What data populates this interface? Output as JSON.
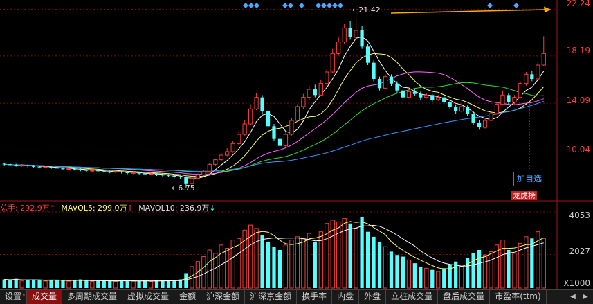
{
  "price_axis": {
    "labels": [
      {
        "value": "22.24",
        "color": "#ff3b3b"
      },
      {
        "value": "18.19",
        "color": "#ff3b3b"
      },
      {
        "value": "14.09",
        "color": "#ff3b3b"
      },
      {
        "value": "10.04",
        "color": "#ff3b3b"
      }
    ]
  },
  "volume_axis": {
    "labels": [
      {
        "value": "4053"
      },
      {
        "value": "2027"
      },
      {
        "value": "X1000"
      }
    ]
  },
  "annotations": {
    "high": "21.42",
    "low": "6.75"
  },
  "volume_legend": {
    "total_label": "总手: 292.9万",
    "total_arrow": "↑",
    "ma5_label": "MAVOL5: 299.0万",
    "ma5_arrow": "↑",
    "ma10_label": "MAVOL10: 236.9万",
    "ma10_arrow": "↓"
  },
  "add_select_button": "加自选",
  "rank_badge": "龙虎榜",
  "tabs": [
    {
      "label": "设置",
      "dot": true,
      "active": false
    },
    {
      "label": "成交量",
      "dot": false,
      "active": true
    },
    {
      "label": "多周期成交量",
      "dot": false,
      "active": false
    },
    {
      "label": "虚拟成交量",
      "dot": false,
      "active": false
    },
    {
      "label": "金额",
      "dot": false,
      "active": false
    },
    {
      "label": "沪深金额",
      "dot": false,
      "active": false
    },
    {
      "label": "沪深京金额",
      "dot": false,
      "active": false
    },
    {
      "label": "换手率",
      "dot": false,
      "active": false
    },
    {
      "label": "内盘",
      "dot": false,
      "active": false
    },
    {
      "label": "外盘",
      "dot": false,
      "active": false
    },
    {
      "label": "立桩成交量",
      "dot": false,
      "active": false
    },
    {
      "label": "盘后成交量",
      "dot": false,
      "active": false
    },
    {
      "label": "市盈率(ttm)",
      "dot": false,
      "active": false
    }
  ],
  "colors": {
    "up": "#ff3b3b",
    "down": "#54ffff",
    "ma5": "#ffffff",
    "ma10": "#ffff66",
    "ma20": "#ff66ff",
    "ma30": "#33dd33",
    "ma60": "#3399ff",
    "grid": "#7a1010"
  },
  "chart_data": {
    "type": "candlestick",
    "price_ylim": [
      6.0,
      22.8
    ],
    "volume_ylim_x1000": [
      0,
      4600
    ],
    "candles": [
      [
        8.85,
        8.8,
        8.95,
        8.7,
        520
      ],
      [
        8.8,
        8.75,
        8.9,
        8.65,
        480
      ],
      [
        8.75,
        8.7,
        8.85,
        8.6,
        560
      ],
      [
        8.7,
        8.72,
        8.82,
        8.6,
        430
      ],
      [
        8.72,
        8.65,
        8.8,
        8.55,
        470
      ],
      [
        8.65,
        8.6,
        8.75,
        8.5,
        520
      ],
      [
        8.6,
        8.55,
        8.7,
        8.45,
        460
      ],
      [
        8.55,
        8.58,
        8.68,
        8.45,
        420
      ],
      [
        8.58,
        8.5,
        8.65,
        8.4,
        500
      ],
      [
        8.5,
        8.45,
        8.6,
        8.35,
        480
      ],
      [
        8.45,
        8.4,
        8.55,
        8.3,
        440
      ],
      [
        8.4,
        8.42,
        8.52,
        8.3,
        410
      ],
      [
        8.42,
        8.35,
        8.5,
        8.25,
        460
      ],
      [
        8.35,
        8.3,
        8.45,
        8.2,
        520
      ],
      [
        8.3,
        8.25,
        8.4,
        8.15,
        440
      ],
      [
        8.25,
        8.28,
        8.38,
        8.15,
        400
      ],
      [
        8.28,
        8.2,
        8.35,
        8.1,
        430
      ],
      [
        8.2,
        8.15,
        8.3,
        8.05,
        470
      ],
      [
        8.15,
        8.12,
        8.25,
        8.02,
        420
      ],
      [
        8.12,
        8.18,
        8.28,
        8.05,
        400
      ],
      [
        8.18,
        8.1,
        8.25,
        8.0,
        440
      ],
      [
        8.1,
        8.05,
        8.2,
        7.95,
        460
      ],
      [
        8.05,
        8.08,
        8.18,
        7.95,
        410
      ],
      [
        8.08,
        8.0,
        8.15,
        7.9,
        430
      ],
      [
        8.0,
        7.95,
        8.1,
        7.85,
        450
      ],
      [
        7.95,
        7.98,
        8.08,
        7.85,
        400
      ],
      [
        7.98,
        7.9,
        8.05,
        7.8,
        470
      ],
      [
        7.9,
        7.85,
        8.0,
        7.75,
        440
      ],
      [
        7.85,
        7.8,
        7.95,
        7.7,
        460
      ],
      [
        7.8,
        7.75,
        7.9,
        7.65,
        490
      ],
      [
        7.75,
        7.7,
        7.85,
        7.55,
        520
      ],
      [
        7.7,
        7.15,
        7.75,
        6.75,
        900
      ],
      [
        7.15,
        7.6,
        7.7,
        7.05,
        1300
      ],
      [
        7.6,
        7.9,
        8.0,
        7.5,
        1600
      ],
      [
        7.9,
        8.2,
        8.3,
        7.8,
        1900
      ],
      [
        8.2,
        8.8,
        8.9,
        8.1,
        2300
      ],
      [
        8.8,
        9.2,
        9.3,
        8.7,
        2100
      ],
      [
        9.2,
        9.6,
        9.8,
        9.1,
        2600
      ],
      [
        9.6,
        9.9,
        10.2,
        9.5,
        2400
      ],
      [
        9.9,
        10.6,
        10.8,
        9.8,
        2900
      ],
      [
        10.6,
        11.4,
        11.6,
        10.5,
        3000
      ],
      [
        11.4,
        12.3,
        12.6,
        11.3,
        3500
      ],
      [
        12.3,
        13.6,
        14.0,
        12.2,
        3800
      ],
      [
        13.6,
        14.6,
        15.0,
        13.5,
        3600
      ],
      [
        14.6,
        13.4,
        14.8,
        13.2,
        3200
      ],
      [
        13.4,
        12.1,
        13.6,
        11.9,
        2800
      ],
      [
        12.1,
        11.0,
        12.3,
        10.8,
        2500
      ],
      [
        11.0,
        10.4,
        11.3,
        10.2,
        2300
      ],
      [
        10.4,
        11.4,
        11.6,
        10.3,
        2600
      ],
      [
        11.4,
        12.6,
        12.8,
        11.3,
        2900
      ],
      [
        12.6,
        13.8,
        14.0,
        12.5,
        3100
      ],
      [
        13.8,
        14.6,
        14.9,
        13.6,
        3000
      ],
      [
        14.6,
        15.3,
        15.6,
        14.4,
        3300
      ],
      [
        15.3,
        14.8,
        15.7,
        14.6,
        2800
      ],
      [
        14.8,
        15.8,
        16.1,
        14.7,
        3400
      ],
      [
        15.8,
        16.8,
        17.1,
        15.6,
        3900
      ],
      [
        16.8,
        18.4,
        18.8,
        16.7,
        4100
      ],
      [
        18.4,
        19.4,
        19.8,
        18.2,
        4000
      ],
      [
        19.4,
        20.6,
        21.0,
        19.2,
        4200
      ],
      [
        20.6,
        19.8,
        21.2,
        19.6,
        3900
      ],
      [
        19.8,
        20.4,
        21.42,
        19.6,
        3600
      ],
      [
        20.4,
        19.0,
        20.8,
        18.8,
        4300
      ],
      [
        19.0,
        17.6,
        19.2,
        17.4,
        3400
      ],
      [
        17.6,
        16.2,
        17.8,
        16.0,
        3100
      ],
      [
        16.2,
        15.4,
        16.4,
        15.2,
        2800
      ],
      [
        15.4,
        16.4,
        16.6,
        15.3,
        2500
      ],
      [
        16.4,
        15.8,
        16.6,
        15.6,
        2200
      ],
      [
        15.8,
        15.2,
        16.0,
        15.0,
        2000
      ],
      [
        15.2,
        14.6,
        15.4,
        14.4,
        1900
      ],
      [
        14.6,
        15.1,
        15.3,
        14.5,
        1700
      ],
      [
        15.1,
        14.9,
        15.3,
        14.7,
        1500
      ],
      [
        14.9,
        14.6,
        15.1,
        14.4,
        1300
      ],
      [
        14.6,
        14.8,
        15.0,
        14.5,
        1200
      ],
      [
        14.8,
        14.4,
        14.9,
        14.2,
        1100
      ],
      [
        14.4,
        14.6,
        14.8,
        14.3,
        1000
      ],
      [
        14.6,
        14.2,
        14.7,
        14.0,
        1200
      ],
      [
        14.2,
        13.8,
        14.4,
        13.6,
        1400
      ],
      [
        13.8,
        13.4,
        14.0,
        13.2,
        1600
      ],
      [
        13.4,
        13.8,
        14.0,
        13.3,
        1300
      ],
      [
        13.8,
        13.2,
        13.9,
        13.0,
        1800
      ],
      [
        13.2,
        12.4,
        13.4,
        12.2,
        2100
      ],
      [
        12.4,
        12.0,
        12.6,
        11.8,
        2300
      ],
      [
        12.0,
        12.6,
        12.8,
        11.9,
        2000
      ],
      [
        12.6,
        13.2,
        13.4,
        12.5,
        2200
      ],
      [
        13.2,
        14.0,
        14.2,
        13.1,
        2600
      ],
      [
        14.0,
        14.8,
        15.2,
        13.9,
        2900
      ],
      [
        14.8,
        14.2,
        15.0,
        14.0,
        2300
      ],
      [
        14.2,
        14.6,
        14.8,
        14.0,
        2100
      ],
      [
        14.6,
        15.8,
        16.0,
        14.5,
        2700
      ],
      [
        15.8,
        16.6,
        16.8,
        15.6,
        3100
      ],
      [
        16.6,
        16.2,
        16.9,
        16.0,
        3000
      ],
      [
        16.2,
        17.4,
        17.7,
        16.1,
        3400
      ],
      [
        17.4,
        18.4,
        19.9,
        17.3,
        3000
      ]
    ]
  }
}
